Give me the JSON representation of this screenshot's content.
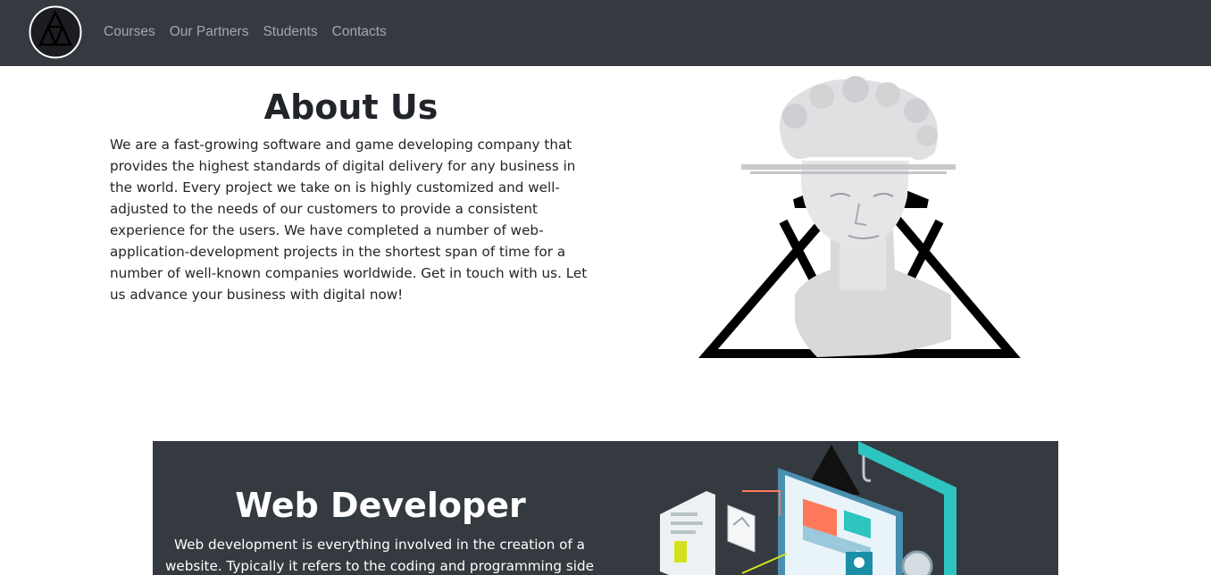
{
  "nav": {
    "logo_icon": "triangle-logo-icon",
    "links": [
      {
        "label": "Courses"
      },
      {
        "label": "Our Partners"
      },
      {
        "label": "Students"
      },
      {
        "label": "Contacts"
      }
    ]
  },
  "about": {
    "title": "About Us",
    "text": "We are a fast-growing software and game developing company that provides the highest standards of digital delivery for any business in the world. Every project we take on is highly customized and well-adjusted to the needs of our customers to provide a consistent experience for the users. We have completed a number of web-application-development projects in the shortest span of time for a number of well-known companies worldwide. Get in touch with us. Let us advance your business with digital now!",
    "image_icon": "statue-triangle-image"
  },
  "web_dev": {
    "title": "Web Developer",
    "text": "Web development is everything involved in the creation of a website. Typically it refers to the coding and programming side of",
    "image_icon": "isometric-web-illustration"
  },
  "colors": {
    "navbar_bg": "#343a40",
    "nav_link": "rgba(255,255,255,0.55)",
    "accent_teal": "#2ec4c0"
  }
}
